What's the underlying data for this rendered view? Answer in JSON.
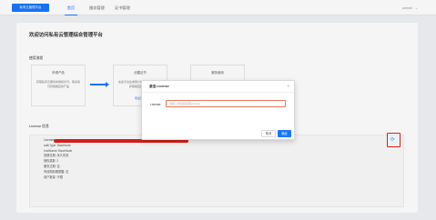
{
  "header": {
    "logo_text": "私有云管理平台",
    "nav": [
      "首页",
      "服务管理",
      "证书管理"
    ],
    "user_name": "admin",
    "user_chevron": "⌄"
  },
  "main": {
    "title": "欢迎访问私有云管理综合管理平台",
    "flow_label": "使用流程",
    "steps": [
      {
        "title": "申请产品",
        "desc": "获取私有云服务的授权许可，联系我们获取相应的产品",
        "link": ""
      },
      {
        "title": "创建证书",
        "desc": "在此平台生成客户端证书，联系我们获取相应授权许可",
        "link": "导出证书"
      },
      {
        "title": "服务使用",
        "desc": "导入证书后即可开始使用服务产品",
        "link": ""
      }
    ],
    "license_label": "License 信息",
    "license_lines": [
      "License:",
      "authType: BaseNode",
      "hostName: BaseNode",
      "到期日期: 永久有效",
      "授权量数: 2",
      "服务过期: 否",
      "有效期到期提醒: 否",
      "用户数量: 不限"
    ],
    "edit_icon": "⟳"
  },
  "modal": {
    "title": "激活 License",
    "close": "×",
    "field_label": "License:",
    "field_placeholder": "请输入激活码获取License",
    "field_value": "",
    "cancel_label": "取消",
    "ok_label": "确定"
  },
  "colors": {
    "primary": "#1677ff",
    "highlight": "#e0201b",
    "input_border": "#e8765b"
  }
}
